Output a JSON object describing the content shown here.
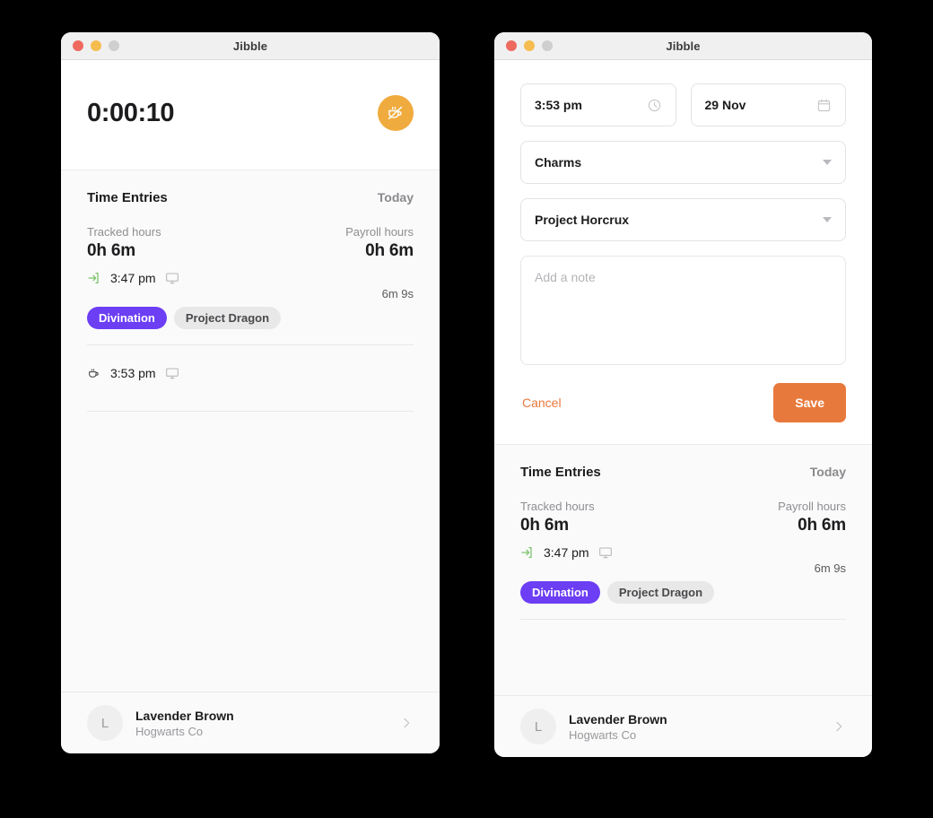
{
  "window_left": {
    "title": "Jibble",
    "traffic_lights": [
      "close-red",
      "minimize-yellow",
      "zoom-gray"
    ],
    "timer": {
      "value": "0:00:10",
      "break_button_icon": "coffee-cup-slash-icon",
      "break_button_color": "#f0ab3f"
    },
    "entries": {
      "title": "Time Entries",
      "period": "Today",
      "tracked_label": "Tracked hours",
      "tracked_value": "0h 6m",
      "payroll_label": "Payroll hours",
      "payroll_value": "0h 6m",
      "rows": [
        {
          "type_icon": "clock-in-arrow-icon",
          "time": "3:47 pm",
          "device_icon": "desktop-monitor-icon",
          "duration": "6m 9s",
          "chips": [
            {
              "label": "Divination",
              "style": "primary",
              "color": "#6c3ef4"
            },
            {
              "label": "Project Dragon",
              "style": "muted",
              "color": "#e8e8e8"
            }
          ]
        },
        {
          "type_icon": "coffee-cup-icon",
          "time": "3:53 pm",
          "device_icon": "desktop-monitor-icon",
          "duration": "",
          "chips": []
        }
      ]
    },
    "footer": {
      "avatar_initial": "L",
      "name": "Lavender Brown",
      "org": "Hogwarts Co",
      "chevron_icon": "chevron-right-icon"
    }
  },
  "window_right": {
    "title": "Jibble",
    "traffic_lights": [
      "close-red",
      "minimize-yellow",
      "zoom-gray"
    ],
    "form": {
      "time_value": "3:53 pm",
      "time_icon": "clock-icon",
      "date_value": "29 Nov",
      "date_icon": "calendar-icon",
      "activity_value": "Charms",
      "activity_icon": "chevron-down-icon",
      "project_value": "Project Horcrux",
      "project_icon": "chevron-down-icon",
      "note_value": "",
      "note_placeholder": "Add a note",
      "cancel_label": "Cancel",
      "save_label": "Save",
      "accent_color": "#e8793c"
    },
    "entries": {
      "title": "Time Entries",
      "period": "Today",
      "tracked_label": "Tracked hours",
      "tracked_value": "0h 6m",
      "payroll_label": "Payroll hours",
      "payroll_value": "0h 6m",
      "rows": [
        {
          "type_icon": "clock-in-arrow-icon",
          "time": "3:47 pm",
          "device_icon": "desktop-monitor-icon",
          "duration": "6m 9s",
          "chips": [
            {
              "label": "Divination",
              "style": "primary",
              "color": "#6c3ef4"
            },
            {
              "label": "Project Dragon",
              "style": "muted",
              "color": "#e8e8e8"
            }
          ]
        }
      ]
    },
    "footer": {
      "avatar_initial": "L",
      "name": "Lavender Brown",
      "org": "Hogwarts Co",
      "chevron_icon": "chevron-right-icon"
    }
  }
}
